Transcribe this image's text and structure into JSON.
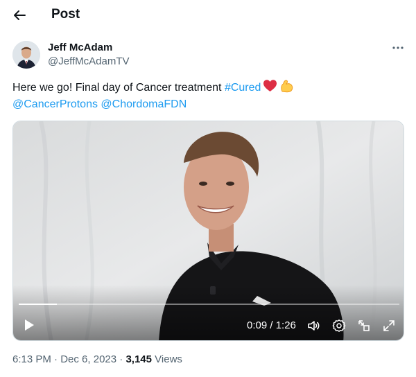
{
  "header": {
    "title": "Post",
    "back_icon": "arrow-left-icon"
  },
  "author": {
    "name": "Jeff McAdam",
    "handle": "@JeffMcAdamTV"
  },
  "tweet": {
    "text_line1": "Here we go! Final day of Cancer treatment",
    "hashtag": "#Cured",
    "emojis": [
      "red-heart-icon",
      "flexed-biceps-icon"
    ],
    "mention1": "@CancerProtons",
    "mention2": "@ChordomaFDN"
  },
  "video": {
    "time_display": "0:09 / 1:26",
    "progress_fraction": 0.1,
    "controls": [
      "play-icon",
      "volume-icon",
      "settings-icon",
      "pip-icon",
      "fullscreen-icon"
    ]
  },
  "meta": {
    "time": "6:13 PM",
    "date": "Dec 6, 2023",
    "views_count": "3,145",
    "views_label": "Views",
    "separator": "·"
  },
  "colors": {
    "link": "#1d9bf0",
    "secondary_text": "#536471",
    "primary_text": "#0f1419"
  }
}
